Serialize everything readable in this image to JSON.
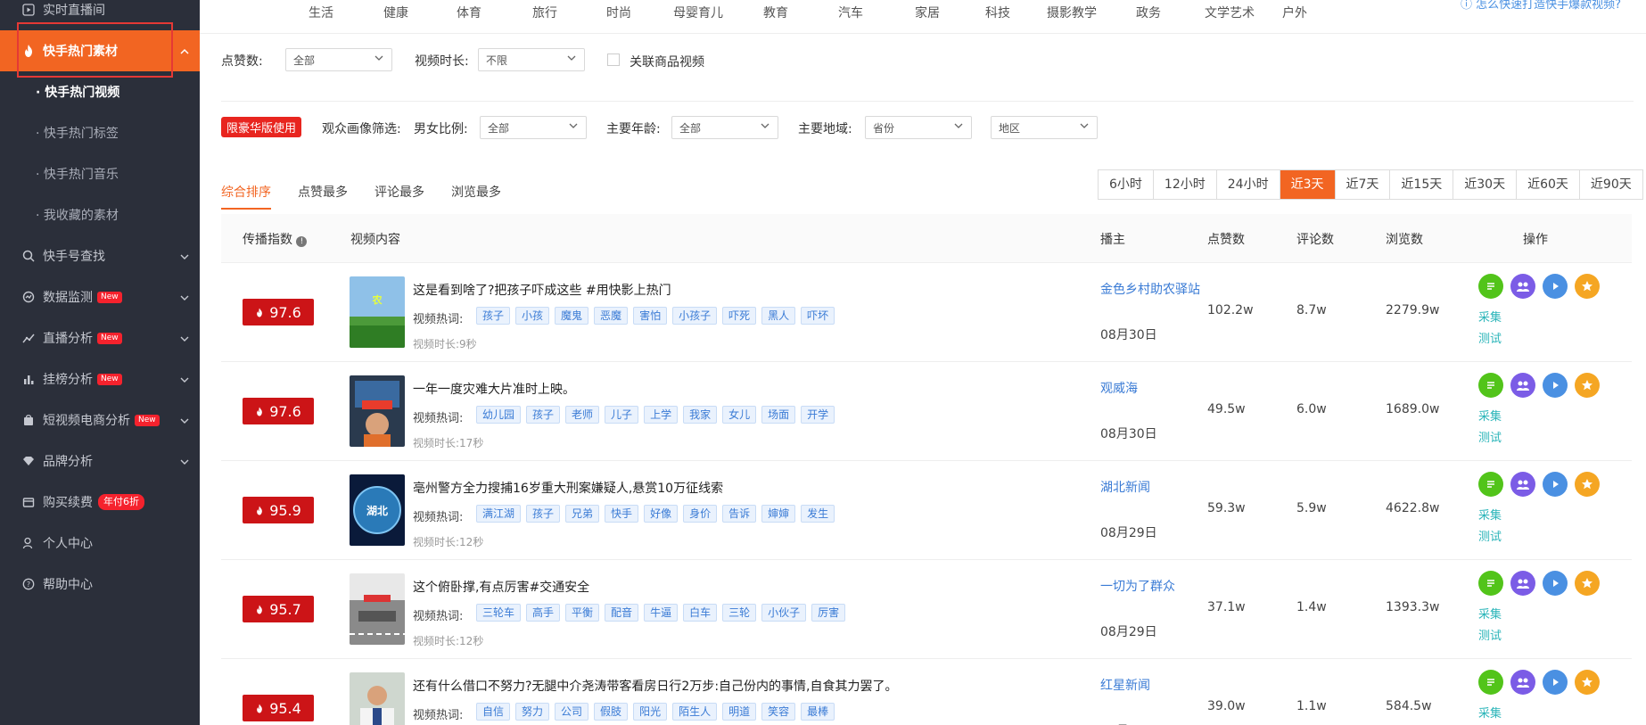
{
  "sidebar": {
    "top_item": "实时直播间",
    "active": "快手热门素材",
    "subs": [
      "· 快手热门视频",
      "· 快手热门标签",
      "· 快手热门音乐",
      "· 我收藏的素材"
    ],
    "items": [
      {
        "label": "快手号查找",
        "icon": "search-icon",
        "badge": ""
      },
      {
        "label": "数据监测",
        "icon": "monitor-icon",
        "badge": "New"
      },
      {
        "label": "直播分析",
        "icon": "trend-icon",
        "badge": "New"
      },
      {
        "label": "挂榜分析",
        "icon": "bar-chart-icon",
        "badge": "New"
      },
      {
        "label": "短视频电商分析",
        "icon": "shopping-bag-icon",
        "badge": "New"
      },
      {
        "label": "品牌分析",
        "icon": "diamond-icon",
        "badge": ""
      },
      {
        "label": "购买续费",
        "icon": "wallet-icon",
        "badge": "年付6折"
      },
      {
        "label": "个人中心",
        "icon": "user-icon",
        "badge": ""
      },
      {
        "label": "帮助中心",
        "icon": "help-icon",
        "badge": ""
      }
    ]
  },
  "categories": [
    "生活",
    "健康",
    "体育",
    "旅行",
    "时尚",
    "母婴育儿",
    "教育",
    "汽车",
    "家居",
    "科技",
    "摄影教学",
    "政务",
    "文学艺术",
    "户外"
  ],
  "help_link": "怎么快速打造快手爆款视频?",
  "filters": {
    "likes_label": "点赞数:",
    "likes_value": "全部",
    "duration_label": "视频时长:",
    "duration_value": "不限",
    "related_goods": "关联商品视频",
    "lux_badge": "限豪华版使用",
    "audience_label": "观众画像筛选:",
    "gender_label": "男女比例:",
    "gender_value": "全部",
    "age_label": "主要年龄:",
    "age_value": "全部",
    "region_label": "主要地域:",
    "province_value": "省份",
    "area_value": "地区"
  },
  "sort_tabs": [
    "综合排序",
    "点赞最多",
    "评论最多",
    "浏览最多"
  ],
  "time_ranges": [
    "6小时",
    "12小时",
    "24小时",
    "近3天",
    "近7天",
    "近15天",
    "近30天",
    "近60天",
    "近90天"
  ],
  "time_selected": "近3天",
  "table": {
    "headers": {
      "index": "传播指数",
      "content": "视频内容",
      "anchor": "播主",
      "likes": "点赞数",
      "comments": "评论数",
      "views": "浏览数",
      "ops": "操作"
    },
    "hot_label": "视频热词:",
    "op_collect": "采集",
    "op_test": "测试",
    "rows": [
      {
        "score": "97.6",
        "title": "这是看到啥了?把孩子吓成这些 #用快影上热门",
        "tags": [
          "孩子",
          "小孩",
          "魔鬼",
          "恶魔",
          "害怕",
          "小孩子",
          "吓死",
          "黑人",
          "吓坏"
        ],
        "duration": "视频时长:9秒",
        "anchor": "金色乡村助农驿站",
        "date": "08月30日",
        "likes": "102.2w",
        "comments": "8.7w",
        "views": "2279.9w",
        "thumb": "rural"
      },
      {
        "score": "97.6",
        "title": "一年一度灾难大片准时上映。",
        "tags": [
          "幼儿园",
          "孩子",
          "老师",
          "儿子",
          "上学",
          "我家",
          "女儿",
          "场面",
          "开学"
        ],
        "duration": "视频时长:17秒",
        "anchor": "观威海",
        "date": "08月30日",
        "likes": "49.5w",
        "comments": "6.0w",
        "views": "1689.0w",
        "thumb": "kid"
      },
      {
        "score": "95.9",
        "title": "亳州警方全力搜捕16岁重大刑案嫌疑人,悬赏10万征线索",
        "tags": [
          "满江湖",
          "孩子",
          "兄弟",
          "快手",
          "好像",
          "身价",
          "告诉",
          "婶婶",
          "发生"
        ],
        "duration": "视频时长:12秒",
        "anchor": "湖北新闻",
        "date": "08月29日",
        "likes": "59.3w",
        "comments": "5.9w",
        "views": "4622.8w",
        "thumb": "news"
      },
      {
        "score": "95.7",
        "title": "这个俯卧撑,有点厉害#交通安全",
        "tags": [
          "三轮车",
          "高手",
          "平衡",
          "配音",
          "牛逼",
          "白车",
          "三轮",
          "小伙子",
          "厉害"
        ],
        "duration": "视频时长:12秒",
        "anchor": "一切为了群众",
        "date": "08月29日",
        "likes": "37.1w",
        "comments": "1.4w",
        "views": "1393.3w",
        "thumb": "road"
      },
      {
        "score": "95.4",
        "title": "还有什么借口不努力?无腿中介尧涛带客看房日行2万步:自己份内的事情,自食其力罢了。",
        "tags": [
          "自信",
          "努力",
          "公司",
          "假肢",
          "阳光",
          "陌生人",
          "明道",
          "笑容",
          "最棒"
        ],
        "duration": "",
        "anchor": "红星新闻",
        "date": "08月29日",
        "likes": "39.0w",
        "comments": "1.1w",
        "views": "584.5w",
        "thumb": "man"
      }
    ]
  },
  "colors": {
    "accent": "#f26522",
    "sidebar_bg": "#2b2f3a",
    "score_red": "#cc1417",
    "link_blue": "#3a7bd5"
  }
}
